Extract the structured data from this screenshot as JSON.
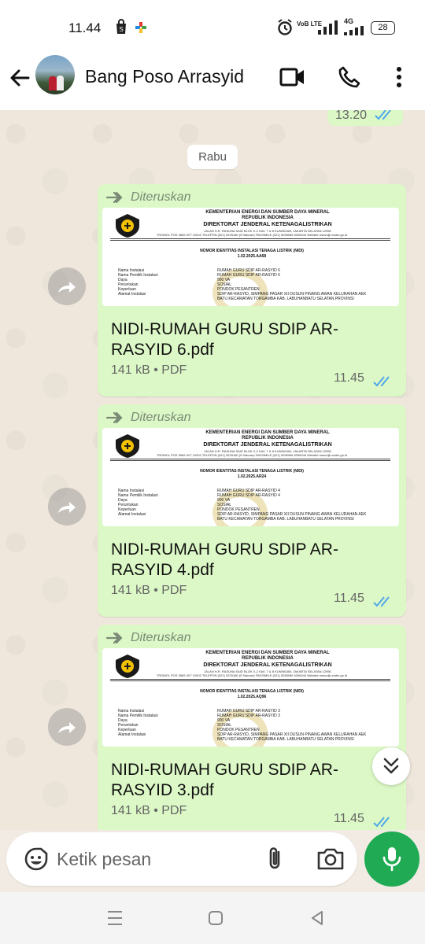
{
  "status_bar": {
    "time": "11.44",
    "battery": "28",
    "network": "4G",
    "volte": "VoB LTE"
  },
  "header": {
    "contact_name": "Bang Poso Arrasyid"
  },
  "chat": {
    "previous_message_time": "13.20",
    "date_chip": "Rabu",
    "messages": [
      {
        "forwarded_label": "Diteruskan",
        "file_name": "NIDI-RUMAH GURU SDIP AR-RASYID 6.pdf",
        "file_meta": "141 kB • PDF",
        "time": "11.45",
        "doc": {
          "ministry": "KEMENTERIAN ENERGI DAN SUMBER DAYA MINERAL",
          "country": "REPUBLIK INDONESIA",
          "directorate": "DIREKTORAT JENDERAL KETENAGALISTRIKAN",
          "address": "JALAN H.R. RASUNA SAID BLOK X-2 KAV. 7 & 8 KUNINGAN, JAKARTA SELATAN 12950",
          "contact": "TROMOL POS 3669 JKT 10002 TELEPON (021) 5225180 (5 Saluran) FAKSIMILE (021) 5256066 5256044 Website www.djk.esdm.go.id",
          "title": "NOMOR IDENTITAS INSTALASI TENAGA LISTRIK (NIDI)",
          "number": "1.02.2025.AA68",
          "fields": [
            "Nama Instalasi",
            "Nama Pemilik Instalasi",
            "Daya",
            "Peruntukan",
            "Keperluan",
            "Alamat Instalasi"
          ],
          "values": [
            "RUMAH GURU SDIP AR-RASYID 6",
            "RUMAH GURU SDIP AR-RASYID 6",
            "900 VA",
            "SOSIAL",
            "PONDOK PESANTREN",
            "SDIP AR-RASYID, SIMPANG PASAR XII DUSUN PINANG AWAN KELURAHAN AEK"
          ],
          "address_cont": "BATU KECAMATAN TORGAMBA KAB. LABUHANBATU SELATAN PROVINSI"
        }
      },
      {
        "forwarded_label": "Diteruskan",
        "file_name": "NIDI-RUMAH GURU SDIP AR-RASYID 4.pdf",
        "file_meta": "141 kB • PDF",
        "time": "11.45",
        "doc": {
          "ministry": "KEMENTERIAN ENERGI DAN SUMBER DAYA MINERAL",
          "country": "REPUBLIK INDONESIA",
          "directorate": "DIREKTORAT JENDERAL KETENAGALISTRIKAN",
          "address": "JALAN H.R. RASUNA SAID BLOK X-2 KAV. 7 & 8 KUNINGAN, JAKARTA SELATAN 12950",
          "contact": "TROMOL POS 3669 JKT 10002 TELEPON (021) 5225180 (5 Saluran) FAKSIMILE (021) 5256066 5256044 Website www.djk.esdm.go.id",
          "title": "NOMOR IDENTITAS INSTALASI TENAGA LISTRIK (NIDI)",
          "number": "1.02.2025.AR24",
          "fields": [
            "Nama Instalasi",
            "Nama Pemilik Instalasi",
            "Daya",
            "Peruntukan",
            "Keperluan",
            "Alamat Instalasi"
          ],
          "values": [
            "RUMAH GURU SDIP AR-RASYID 4",
            "RUMAH GURU SDIP AR-RASYID 4",
            "900 VA",
            "SOSIAL",
            "PONDOK PESANTREN",
            "SDIP AR-RASYID, SIMPANG PASAR XII DUSUN PINANG AWAN KELURAHAN AEK"
          ],
          "address_cont": "BATU KECAMATAN TORGAMBA KAB. LABUHANBATU SELATAN PROVINSI"
        }
      },
      {
        "forwarded_label": "Diteruskan",
        "file_name": "NIDI-RUMAH GURU SDIP AR-RASYID 3.pdf",
        "file_meta": "141 kB • PDF",
        "time": "11.45",
        "doc": {
          "ministry": "KEMENTERIAN ENERGI DAN SUMBER DAYA MINERAL",
          "country": "REPUBLIK INDONESIA",
          "directorate": "DIREKTORAT JENDERAL KETENAGALISTRIKAN",
          "address": "JALAN H.R. RASUNA SAID BLOK X-2 KAV. 7 & 8 KUNINGAN, JAKARTA SELATAN 12950",
          "contact": "TROMOL POS 3669 JKT 10002 TELEPON (021) 5225180 (5 Saluran) FAKSIMILE (021) 5256066 5256044 Website www.djk.esdm.go.id",
          "title": "NOMOR IDENTITAS INSTALASI TENAGA LISTRIK (NIDI)",
          "number": "1.02.2025.AQ96",
          "fields": [
            "Nama Instalasi",
            "Nama Pemilik Instalasi",
            "Daya",
            "Peruntukan",
            "Keperluan",
            "Alamat Instalasi"
          ],
          "values": [
            "RUMAH GURU SDIP AR-RASYID 3",
            "RUMAH GURU SDIP AR-RASYID 3",
            "900 VA",
            "SOSIAL",
            "PONDOK PESANTREN",
            "SDIP AR-RASYID, SIMPANG PASAR XII DUSUN PINANG AWAN KELURAHAN AEK"
          ],
          "address_cont": "BATU KECAMATAN TORGAMBA KAB. LABUHANBATU SELATAN PROVINSI"
        }
      }
    ]
  },
  "composer": {
    "placeholder": "Ketik pesan"
  },
  "colors": {
    "bubble": "#dcf8c6",
    "accent_green": "#1faa53",
    "tick_blue": "#4fa8e8"
  },
  "icons": [
    "back-arrow-icon",
    "video-call-icon",
    "phone-icon",
    "more-vert-icon",
    "forward-icon",
    "read-ticks-icon",
    "double-chevron-down-icon",
    "emoji-icon",
    "paperclip-icon",
    "camera-icon",
    "mic-icon",
    "menu-icon",
    "home-icon",
    "back-nav-icon"
  ]
}
